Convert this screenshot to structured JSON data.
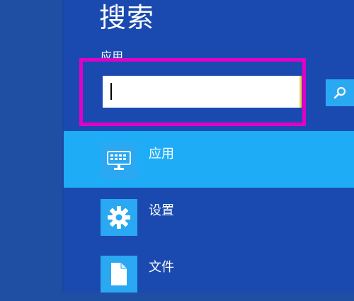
{
  "search_panel": {
    "title": "搜索",
    "scope_label": "应用",
    "query_value": "",
    "search_button_icon": "search-icon"
  },
  "results": [
    {
      "label": "应用",
      "icon": "keyboard-icon",
      "selected": true
    },
    {
      "label": "设置",
      "icon": "gear-icon",
      "selected": false
    },
    {
      "label": "文件",
      "icon": "document-icon",
      "selected": false
    }
  ],
  "colors": {
    "background": "#1f4fa3",
    "highlight_border": "#e100c8",
    "selected_row": "#1eacf6",
    "tile": "#2aa8f2"
  }
}
